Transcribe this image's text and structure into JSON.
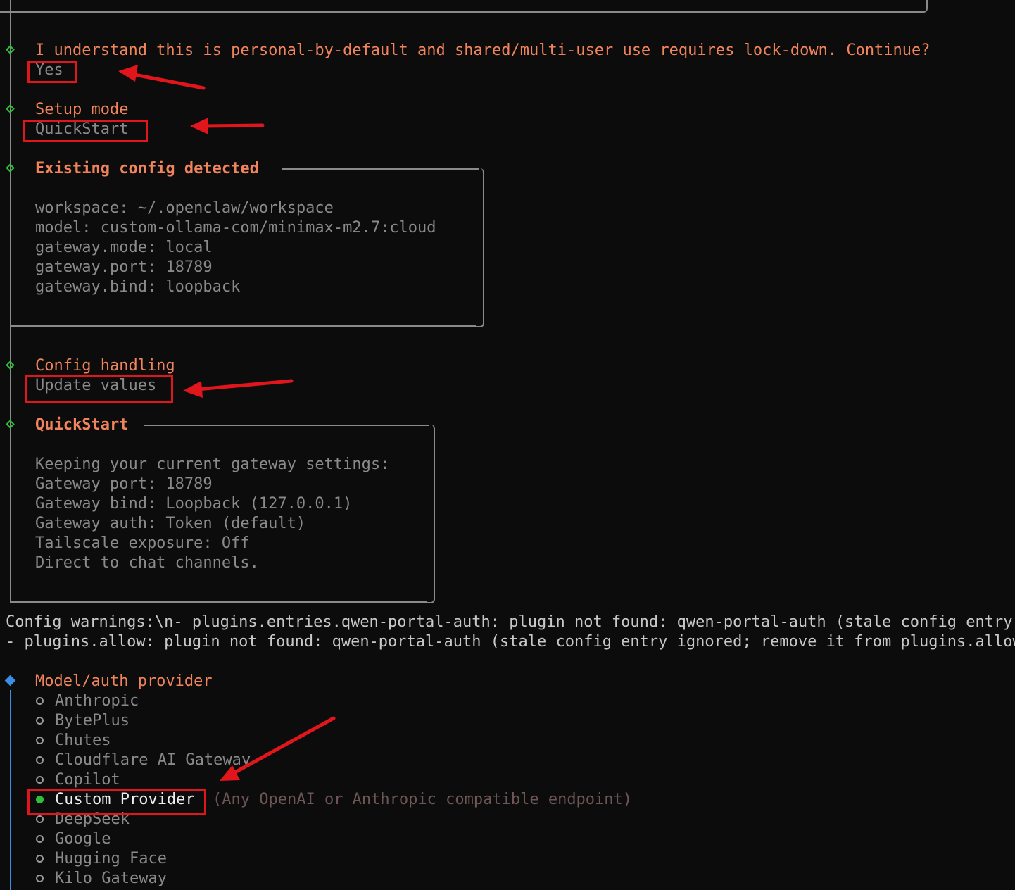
{
  "security_prompt": {
    "question": "I understand this is personal-by-default and shared/multi-user use requires lock-down. Continue?",
    "answer": "Yes"
  },
  "setup_mode": {
    "title": "Setup mode",
    "value": "QuickStart"
  },
  "existing_config": {
    "title": "Existing config detected",
    "lines": [
      "workspace: ~/.openclaw/workspace",
      "model: custom-ollama-com/minimax-m2.7:cloud",
      "gateway.mode: local",
      "gateway.port: 18789",
      "gateway.bind: loopback"
    ]
  },
  "config_handling": {
    "title": "Config handling",
    "value": "Update values"
  },
  "quickstart": {
    "title": "QuickStart",
    "lines": [
      "Keeping your current gateway settings:",
      "Gateway port: 18789",
      "Gateway bind: Loopback (127.0.0.1)",
      "Gateway auth: Token (default)",
      "Tailscale exposure: Off",
      "Direct to chat channels."
    ]
  },
  "warnings": [
    "Config warnings:\\n- plugins.entries.qwen-portal-auth: plugin not found: qwen-portal-auth (stale config entry ignored; remove it from plugins config)",
    "- plugins.allow: plugin not found: qwen-portal-auth (stale config entry ignored; remove it from plugins.allow)"
  ],
  "provider": {
    "title": "Model/auth provider",
    "options": [
      {
        "label": "Anthropic",
        "selected": false
      },
      {
        "label": "BytePlus",
        "selected": false
      },
      {
        "label": "Chutes",
        "selected": false
      },
      {
        "label": "Cloudflare AI Gateway",
        "selected": false
      },
      {
        "label": "Copilot",
        "selected": false
      },
      {
        "label": "Custom Provider",
        "selected": true,
        "hint": "(Any OpenAI or Anthropic compatible endpoint)"
      },
      {
        "label": "DeepSeek",
        "selected": false
      },
      {
        "label": "Google",
        "selected": false
      },
      {
        "label": "Hugging Face",
        "selected": false
      },
      {
        "label": "Kilo Gateway",
        "selected": false
      }
    ]
  },
  "colors": {
    "background": "#0c0c0c",
    "heading": "#f2845c",
    "answer": "#8a8a8a",
    "done_marker": "#2fbf3a",
    "active_marker": "#3a8ee6",
    "annotation": "#e0161c"
  }
}
